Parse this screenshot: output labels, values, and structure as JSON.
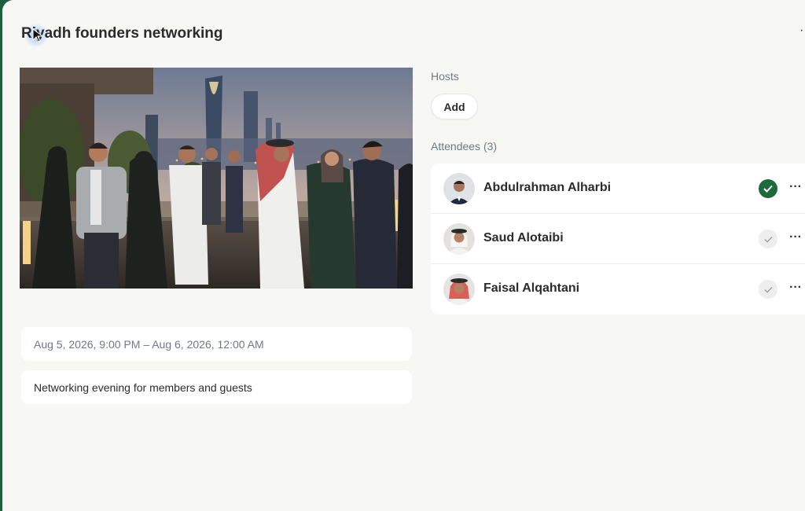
{
  "event": {
    "title": "Riyadh founders networking",
    "date_range": "Aug 5, 2026, 9:00 PM – Aug 6, 2026, 12:00 AM",
    "description": "Networking evening for members and guests"
  },
  "hosts": {
    "label": "Hosts",
    "add_label": "Add"
  },
  "attendees": {
    "label": "Attendees (3)",
    "items": [
      {
        "name": "Abdulrahman Alharbi",
        "status": "confirmed"
      },
      {
        "name": "Saud Alotaibi",
        "status": "pending"
      },
      {
        "name": "Faisal Alqahtani",
        "status": "pending"
      }
    ]
  },
  "menu": {
    "more_glyph": "···"
  },
  "colors": {
    "accent_green": "#1d6b3a",
    "sidebar_green": "#1f5f3a",
    "background": "#f7f7f6"
  },
  "icons": [
    "more-icon",
    "check-icon",
    "cursor-icon"
  ]
}
